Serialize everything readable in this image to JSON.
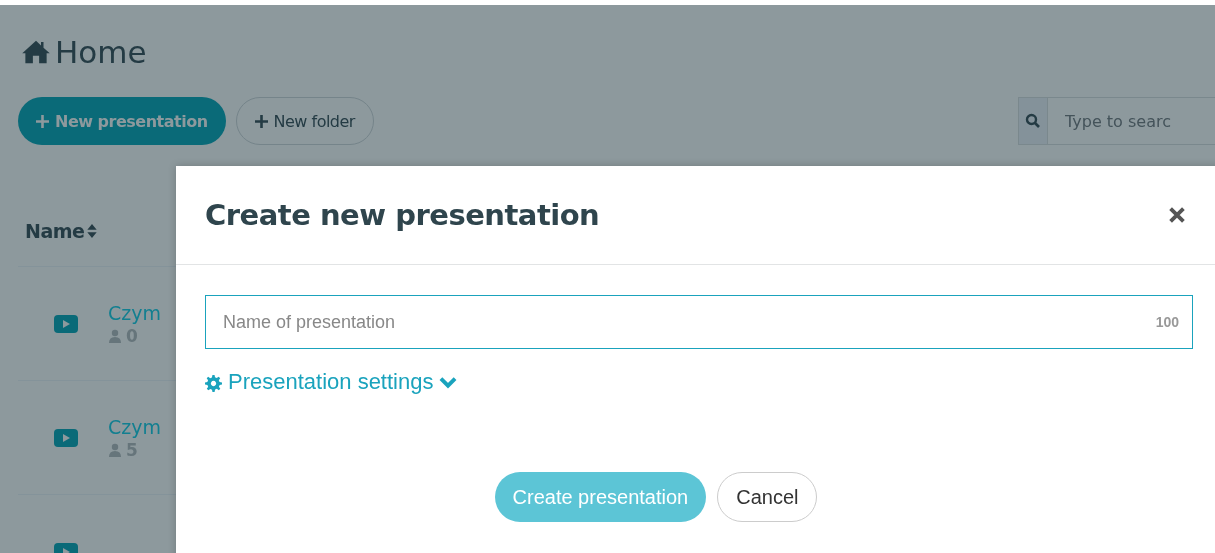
{
  "page": {
    "title": "Home",
    "actions": [
      {
        "label": "New presentation",
        "kind": "primary"
      },
      {
        "label": "New folder",
        "kind": "secondary"
      }
    ],
    "search": {
      "placeholder": "Type to searc"
    },
    "table": {
      "columns": [
        {
          "label": "Name"
        }
      ],
      "rows": [
        {
          "name": "Czym",
          "count": "0"
        },
        {
          "name": "Czym",
          "count": "5"
        },
        {}
      ]
    }
  },
  "dialog": {
    "title": "Create new presentation",
    "name_field": {
      "placeholder": "Name of presentation",
      "counter": "100"
    },
    "settings": {
      "label": "Presentation settings",
      "expanded": false
    },
    "buttons": [
      {
        "label": "Create presentation",
        "kind": "primary",
        "disabled": true
      },
      {
        "label": "Cancel",
        "kind": "secondary",
        "disabled": false
      }
    ]
  }
}
